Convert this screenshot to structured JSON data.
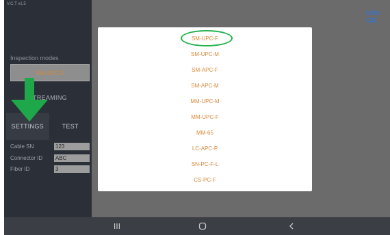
{
  "app": {
    "version": "V.C.T v1.5"
  },
  "left_panel": {
    "section_title": "Inspection modes",
    "selected_mode": "SM-UPC-F",
    "streaming_label": "TREAMING",
    "tabs": [
      {
        "label": "SETTINGS",
        "active": true
      },
      {
        "label": "TEST",
        "active": false
      }
    ],
    "fields": [
      {
        "label": "Cable SN",
        "value": "123"
      },
      {
        "label": "Connector ID",
        "value": "ABC"
      },
      {
        "label": "Fiber ID",
        "value": "3"
      }
    ]
  },
  "header": {
    "info_label": "Info OS"
  },
  "dialog": {
    "options": [
      "SM-UPC-F",
      "SM-UPC-M",
      "SM-APC-F",
      "SM-APC-M",
      "MM-UPC-M",
      "MM-UPC-F",
      "MM-65",
      "LC-APC-P",
      "SN-PC-F-L",
      "CS-PC-F"
    ],
    "highlighted_index": 0,
    "highlight_color": "#22b04b",
    "option_color": "#d8893a"
  },
  "annotation": {
    "arrow_color": "#1fa84a",
    "arrow_icon": "down-arrow-icon"
  },
  "navbar": {
    "icons": [
      "recent-apps-icon",
      "home-icon",
      "back-icon"
    ]
  }
}
